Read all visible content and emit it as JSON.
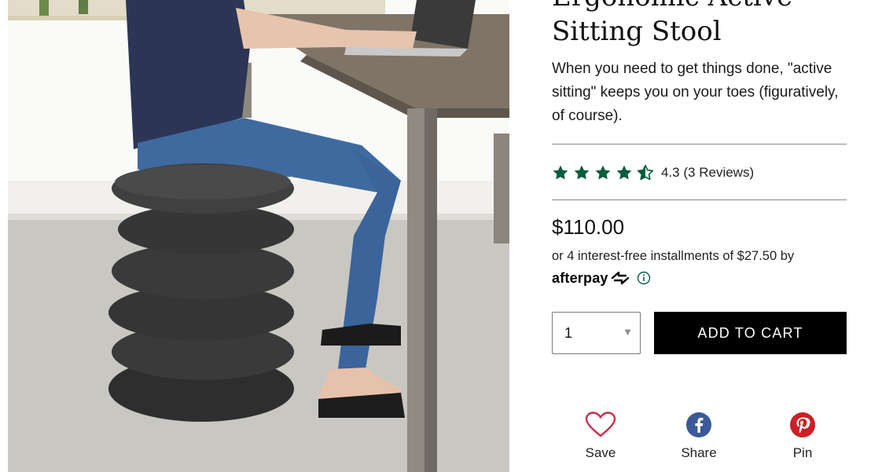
{
  "product": {
    "title": "Ergonomic Active Sitting Stool",
    "description": "When you need to get things done, \"active sitting\" keeps you on your toes (figuratively, of course).",
    "rating": 4.3,
    "rating_label": "4.3",
    "reviews_label": "(3 Reviews)",
    "price": "$110.00",
    "installments_text": "or 4 interest-free installments of $27.50 by",
    "afterpay_word": "afterpay",
    "image_alt": "Person seated on a black ergonomic stool at a desk"
  },
  "cart": {
    "quantity": "1",
    "add_label": "ADD TO CART"
  },
  "share": {
    "save_label": "Save",
    "share_label": "Share",
    "pin_label": "Pin"
  },
  "colors": {
    "star": "#0a5c3e",
    "save_heart": "#c8304a",
    "facebook": "#3b5998",
    "pinterest": "#cb2027",
    "button": "#000000"
  },
  "icons": [
    "star-icon",
    "half-star-icon",
    "afterpay-logo-icon",
    "info-icon",
    "chevron-down-icon",
    "heart-icon",
    "facebook-icon",
    "pinterest-icon"
  ]
}
